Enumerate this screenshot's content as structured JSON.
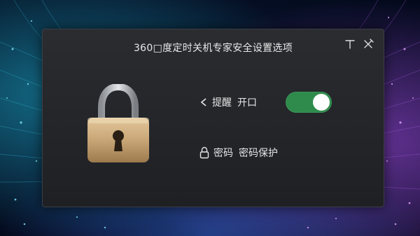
{
  "dialog": {
    "title": "360□度定时关机专家安全设置选项"
  },
  "reminder": {
    "label": "提醒",
    "status": "开口",
    "enabled": true
  },
  "password": {
    "label": "密码",
    "action": "密码保护"
  },
  "colors": {
    "toggle_on": "#2e8b4c",
    "dialog_bg": "#24262a",
    "text": "#e6e6e6"
  },
  "icons": {
    "pin": "pin-icon",
    "close": "close-icon",
    "back": "chevron-left-icon",
    "lock_large": "padlock-icon",
    "lock_small": "lock-icon"
  }
}
